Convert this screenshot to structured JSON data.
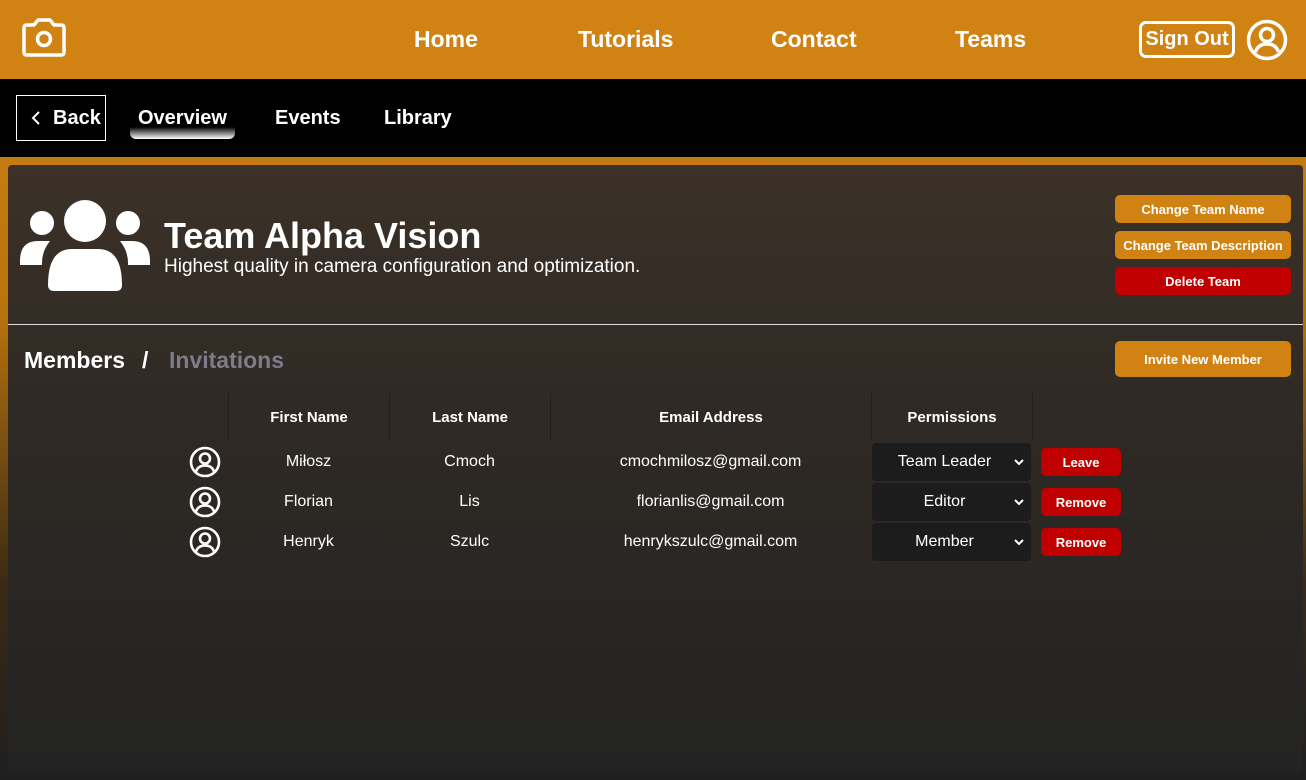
{
  "topnav": {
    "links": [
      "Home",
      "Tutorials",
      "Contact",
      "Teams"
    ],
    "signout_label": "Sign Out",
    "icons": {
      "logo": "camera-icon",
      "account": "user-circle-icon"
    }
  },
  "subnav": {
    "back_label": "Back",
    "tabs": [
      "Overview",
      "Events",
      "Library"
    ],
    "active_tab": "Overview"
  },
  "team": {
    "name": "Team Alpha Vision",
    "description": "Highest quality in camera configuration and optimization.",
    "icon": "users-group-icon",
    "actions": {
      "change_name": "Change Team Name",
      "change_description": "Change Team Description",
      "delete": "Delete Team"
    }
  },
  "members_section": {
    "members_label": "Members",
    "separator": "/",
    "invitations_label": "Invitations",
    "invite_label": "Invite New Member"
  },
  "table": {
    "headers": [
      "First Name",
      "Last Name",
      "Email Address",
      "Permissions"
    ],
    "rows": [
      {
        "first": "Miłosz",
        "last": "Cmoch",
        "email": "cmochmilosz@gmail.com",
        "permission": "Team Leader",
        "action": "Leave"
      },
      {
        "first": "Florian",
        "last": "Lis",
        "email": "florianlis@gmail.com",
        "permission": "Editor",
        "action": "Remove"
      },
      {
        "first": "Henryk",
        "last": "Szulc",
        "email": "henrykszulc@gmail.com",
        "permission": "Member",
        "action": "Remove"
      }
    ]
  },
  "colors": {
    "brand_orange": "#d08312",
    "danger_red": "#c00000",
    "muted_text": "#7c7c8a"
  }
}
